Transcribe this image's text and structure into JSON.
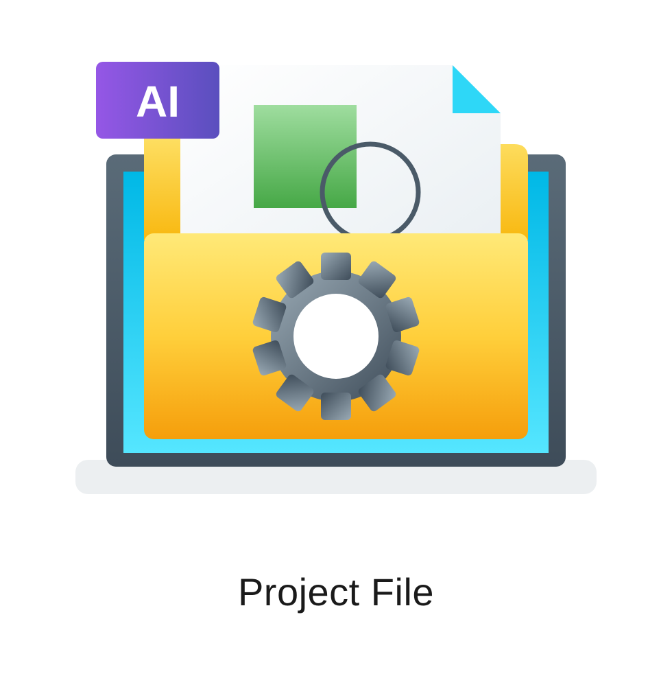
{
  "badge": {
    "label": "AI"
  },
  "caption": "Project File",
  "colors": {
    "folder_top": "#FFE978",
    "folder_bottom": "#F8A610",
    "screen_top": "#00C3E8",
    "screen_bottom": "#3EE0FF",
    "bezel": "#4A5A68",
    "base": "#ECEFF1",
    "badge_left": "#8B4FE0",
    "badge_right": "#5A4FBE",
    "page_corner": "#2ED7F7",
    "square_top": "#8FD98F",
    "square_bottom": "#4CAF50",
    "gear_light": "#8B9CA8",
    "gear_dark": "#3E4C59"
  }
}
